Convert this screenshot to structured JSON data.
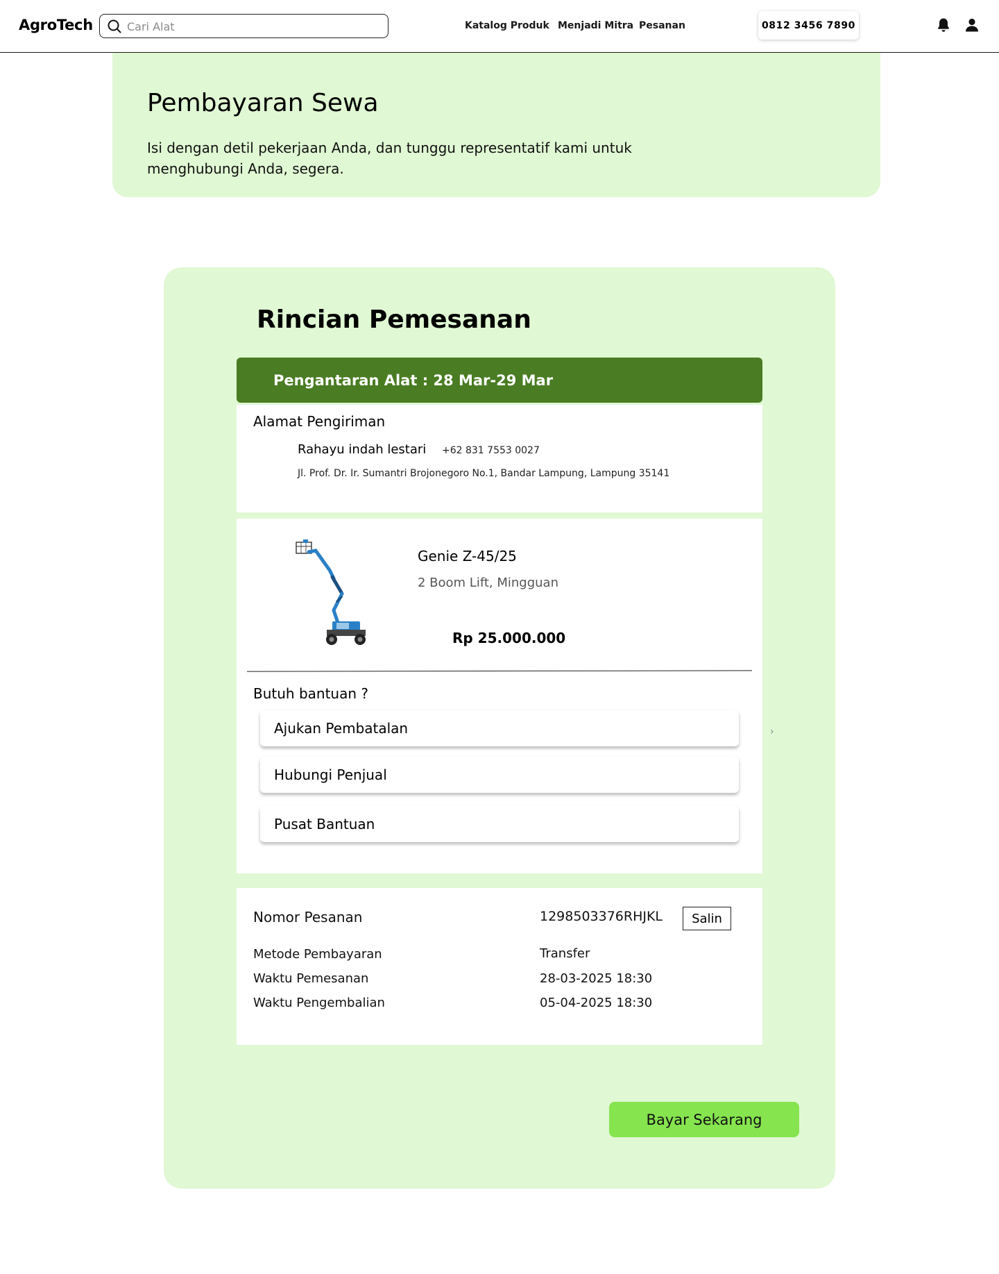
{
  "navbar": {
    "logo": "AgroTech",
    "search_placeholder": "Cari Alat",
    "links": [
      "Katalog Produk",
      "Menjadi Mitra",
      "Pesanan"
    ],
    "phone": "0812 3456 7890",
    "icons": [
      "bell-icon",
      "user-icon"
    ]
  },
  "hero": {
    "title": "Pembayaran Sewa",
    "description": "Isi dengan detil pekerjaan Anda, dan tunggu representatif kami untuk menghubungi Anda, segera."
  },
  "order": {
    "title": "Rincian Pemesanan",
    "delivery": "Pengantaran Alat : 28 Mar-29 Mar",
    "address": {
      "heading": "Alamat Pengiriman",
      "name": "Rahayu indah lestari",
      "phone": "+62 831 7553 0027",
      "line": "Jl. Prof. Dr. Ir. Sumantri Brojonegoro No.1, Bandar Lampung, Lampung 35141"
    },
    "product": {
      "name": "Genie Z-45/25",
      "variant": "2 Boom Lift, Mingguan",
      "price": "Rp 25.000.000"
    },
    "help": {
      "heading": "Butuh bantuan ?",
      "options": [
        "Ajukan Pembatalan",
        "Hubungi Penjual",
        "Pusat Bantuan"
      ],
      "chevron": "›"
    },
    "info": {
      "order_number_label": "Nomor Pesanan",
      "order_number": "1298503376RHJKL",
      "copy_label": "Salin",
      "rows": [
        {
          "label": "Metode Pembayaran",
          "value": "Transfer"
        },
        {
          "label": "Waktu Pemesanan",
          "value": "28-03-2025  18:30"
        },
        {
          "label": "Waktu Pengembalian",
          "value": "05-04-2025  18:30"
        }
      ]
    },
    "pay_label": "Bayar Sekarang"
  },
  "colors": {
    "light_green": "#e0f8d3",
    "dark_green": "#4a7c23",
    "button_green": "#86e44f"
  }
}
